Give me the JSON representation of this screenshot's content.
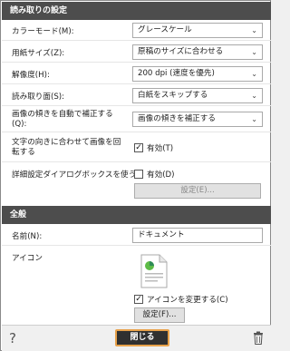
{
  "scan_settings": {
    "header": "読み取りの設定",
    "color_mode": {
      "label": "カラーモード(M):",
      "value": "グレースケール"
    },
    "paper_size": {
      "label": "用紙サイズ(Z):",
      "value": "原稿のサイズに合わせる"
    },
    "resolution": {
      "label": "解像度(H):",
      "value": "200 dpi (速度を優先)"
    },
    "scan_side": {
      "label": "読み取り面(S):",
      "value": "白紙をスキップする"
    },
    "auto_correct": {
      "label": "画像の傾きを自動で補正する(Q):",
      "value": "画像の傾きを補正する"
    },
    "rotate": {
      "label": "文字の向きに合わせて画像を回転する",
      "checkbox_label": "有効(T)",
      "checked": true
    },
    "advanced": {
      "label": "詳細設定ダイアログボックスを使う",
      "checkbox_label": "有効(D)",
      "checked": false,
      "button_label": "設定(E)..."
    }
  },
  "general": {
    "header": "全般",
    "name": {
      "label": "名前(N):",
      "value": "ドキュメント"
    },
    "icon": {
      "label": "アイコン",
      "change_checkbox_label": "アイコンを変更する(C)",
      "change_checked": true,
      "settings_button": "設定(F)..."
    }
  },
  "bottom": {
    "help_symbol": "?",
    "close_label": "閉じる",
    "trash_icon": "trash-icon"
  },
  "colors": {
    "header_bg": "#4d4d4d",
    "close_border": "#e8a24b"
  }
}
